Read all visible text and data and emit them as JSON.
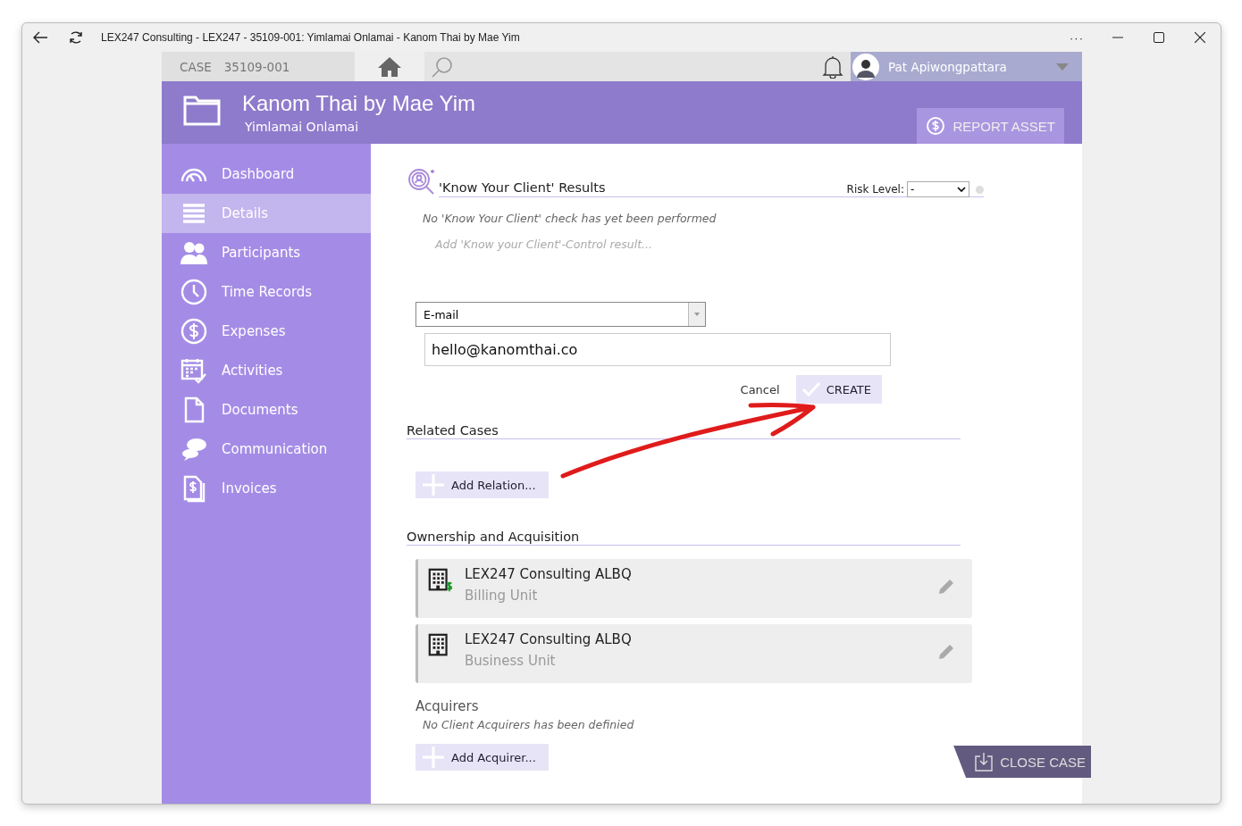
{
  "window": {
    "title": "LEX247 Consulting - LEX247 - 35109-001: Yimlamai Onlamai - Kanom Thai by Mae Yim",
    "more": "···"
  },
  "topbar": {
    "case_label": "CASE",
    "case_number": "35109-001",
    "user": "Pat Apiwongpattara"
  },
  "header": {
    "title": "Kanom Thai by Mae Yim",
    "subtitle": "Yimlamai Onlamai",
    "report_button": "REPORT ASSET"
  },
  "sidebar": {
    "items": [
      {
        "label": "Dashboard",
        "kind": "gauge",
        "selected": false
      },
      {
        "label": "Details",
        "kind": "lines",
        "selected": true
      },
      {
        "label": "Participants",
        "kind": "people",
        "selected": false
      },
      {
        "label": "Time Records",
        "kind": "clock",
        "selected": false
      },
      {
        "label": "Expenses",
        "kind": "dollar",
        "selected": false
      },
      {
        "label": "Activities",
        "kind": "calendar",
        "selected": false
      },
      {
        "label": "Documents",
        "kind": "document",
        "selected": false
      },
      {
        "label": "Communication",
        "kind": "chat",
        "selected": false
      },
      {
        "label": "Invoices",
        "kind": "invoice",
        "selected": false
      }
    ]
  },
  "kyc": {
    "title": "'Know Your Client' Results",
    "risk_label": "Risk Level:",
    "risk_value": "-",
    "empty_note": "No 'Know Your Client' check has yet been performed",
    "add_link": "Add 'Know your Client'-Control result..."
  },
  "contact_form": {
    "type": "E-mail",
    "value": "hello@kanomthai.co",
    "cancel": "Cancel",
    "create": "CREATE"
  },
  "related_cases": {
    "title": "Related Cases",
    "add_button": "Add Relation..."
  },
  "ownership": {
    "title": "Ownership and Acquisition",
    "units": [
      {
        "name": "LEX247 Consulting ALBQ",
        "role": "Billing Unit",
        "kind": "billing"
      },
      {
        "name": "LEX247 Consulting ALBQ",
        "role": "Business Unit",
        "kind": "business"
      }
    ],
    "acquirers_title": "Acquirers",
    "acquirers_note": "No Client Acquirers has been definied",
    "add_button": "Add Acquirer..."
  },
  "close_button": "CLOSE CASE"
}
